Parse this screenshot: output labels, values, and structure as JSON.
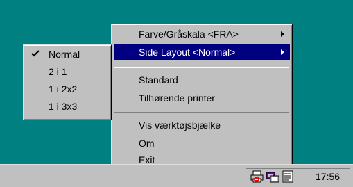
{
  "main_menu": {
    "items": [
      {
        "label": "Farve/Gråskala <FRA>",
        "has_submenu": true
      },
      {
        "label": "Side Layout <Normal>",
        "has_submenu": true,
        "selected": true
      },
      {
        "label": "Standard"
      },
      {
        "label": "Tilhørende printer"
      },
      {
        "label": "Vis værktøjsbjælke"
      },
      {
        "label": "Om"
      },
      {
        "label": "Exit"
      }
    ]
  },
  "submenu": {
    "items": [
      {
        "label": "Normal",
        "checked": true
      },
      {
        "label": "2 i 1"
      },
      {
        "label": "1 i 2x2"
      },
      {
        "label": "1 i 3x3"
      }
    ]
  },
  "taskbar": {
    "clock": "17:56",
    "tray_icons": [
      "printer-icon",
      "network-icon",
      "document-icon"
    ]
  },
  "colors": {
    "desktop": "#008080",
    "menu_face": "#c0c0c0",
    "highlight": "#000080"
  }
}
